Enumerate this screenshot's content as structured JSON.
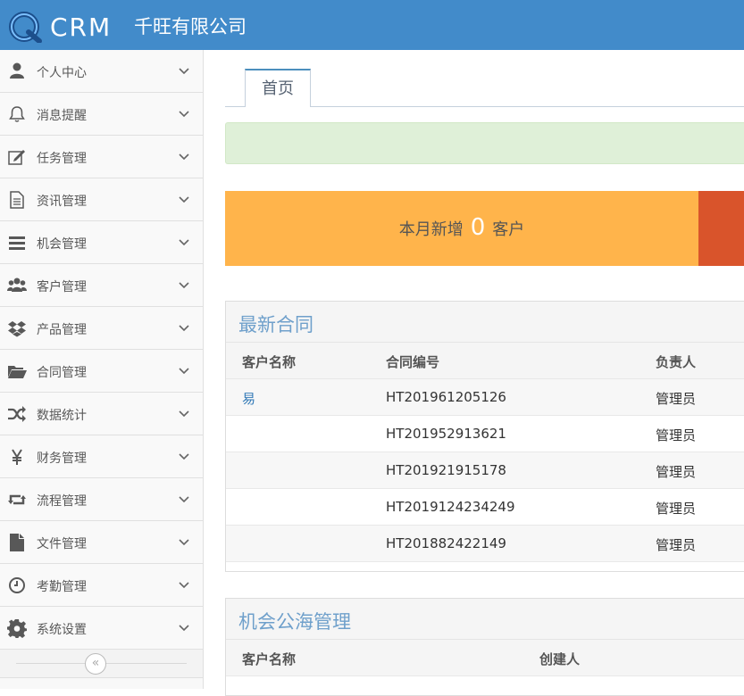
{
  "header": {
    "logo_text": "CRM",
    "company": "千旺有限公司"
  },
  "sidebar": {
    "items": [
      {
        "label": "个人中心",
        "icon": "user-icon"
      },
      {
        "label": "消息提醒",
        "icon": "bell-icon"
      },
      {
        "label": "任务管理",
        "icon": "edit-icon"
      },
      {
        "label": "资讯管理",
        "icon": "document-icon"
      },
      {
        "label": "机会管理",
        "icon": "list-icon"
      },
      {
        "label": "客户管理",
        "icon": "users-icon"
      },
      {
        "label": "产品管理",
        "icon": "dropbox-icon"
      },
      {
        "label": "合同管理",
        "icon": "folder-open-icon"
      },
      {
        "label": "数据统计",
        "icon": "random-icon"
      },
      {
        "label": "财务管理",
        "icon": "yen-icon"
      },
      {
        "label": "流程管理",
        "icon": "retweet-icon"
      },
      {
        "label": "文件管理",
        "icon": "file-icon"
      },
      {
        "label": "考勤管理",
        "icon": "clock-icon"
      },
      {
        "label": "系统设置",
        "icon": "gear-icon"
      }
    ],
    "collapse_glyph": "«"
  },
  "tabs": [
    {
      "label": "首页"
    }
  ],
  "stats": {
    "prefix": "本月新增",
    "count": "0",
    "suffix": "客户"
  },
  "contracts": {
    "title": "最新合同",
    "columns": [
      "客户名称",
      "合同编号",
      "负责人"
    ],
    "rows": [
      {
        "customer": "易",
        "number": "HT201961205126",
        "owner": "管理员"
      },
      {
        "customer": "",
        "number": "HT201952913621",
        "owner": "管理员"
      },
      {
        "customer": "",
        "number": "HT201921915178",
        "owner": "管理员"
      },
      {
        "customer": "",
        "number": "HT2019124234249",
        "owner": "管理员"
      },
      {
        "customer": "",
        "number": "HT201882422149",
        "owner": "管理员"
      }
    ]
  },
  "opportunities": {
    "title": "机会公海管理",
    "columns": [
      "客户名称",
      "创建人"
    ]
  },
  "colors": {
    "topbar": "#428bca",
    "stat_orange": "#ffb44b",
    "stat_red": "#d9542b",
    "alert_green": "#dff0d8",
    "panel_title": "#6fa0cb"
  }
}
